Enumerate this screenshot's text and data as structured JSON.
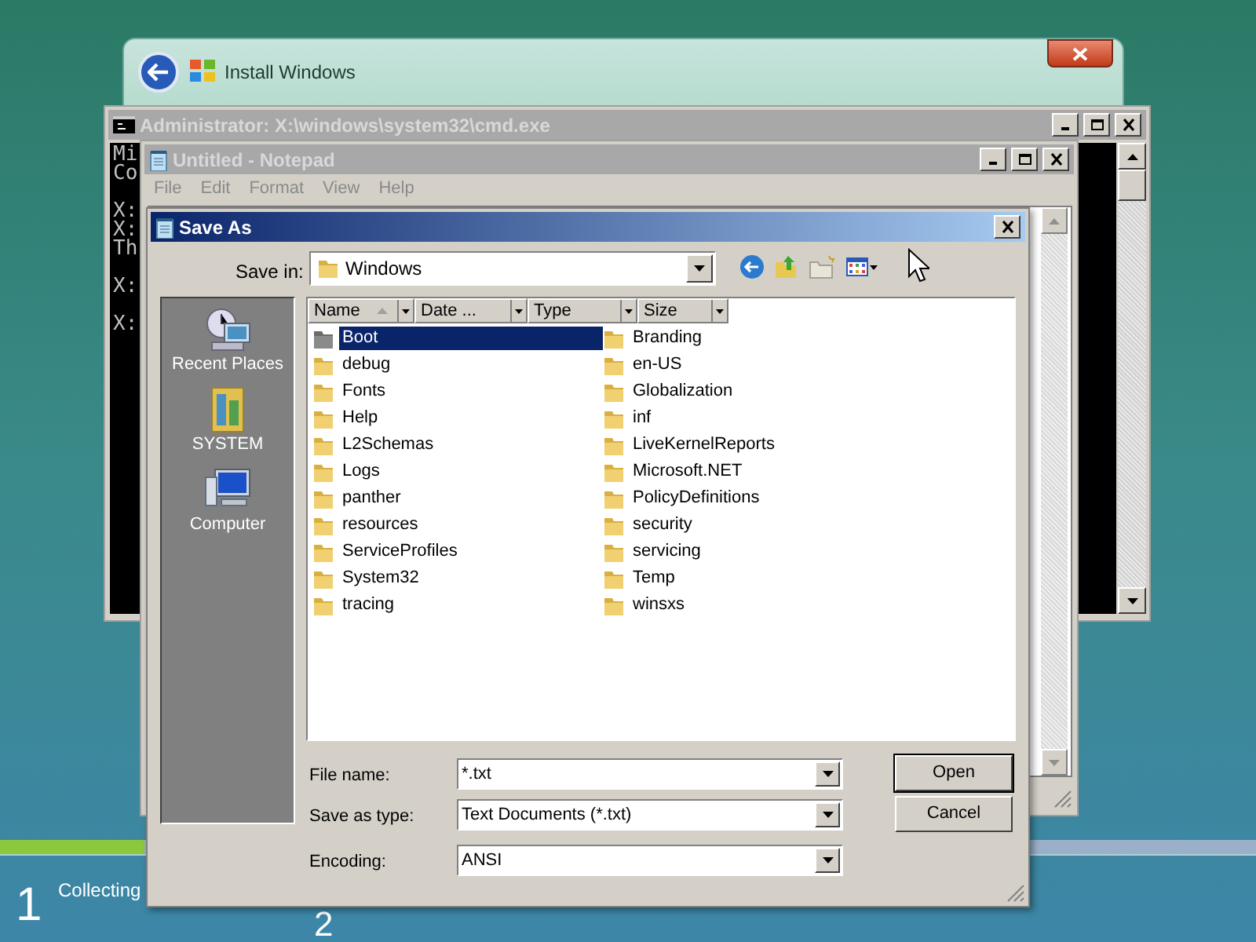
{
  "setup_window": {
    "title": "Install Windows"
  },
  "console_window": {
    "title": "Administrator: X:\\windows\\system32\\cmd.exe",
    "lines": [
      {
        "text": "Mi",
        "blank_before": false
      },
      {
        "text": "Co",
        "blank_before": false
      },
      {
        "text": "X:",
        "blank_before": true
      },
      {
        "text": "X:",
        "blank_before": false
      },
      {
        "text": "Th",
        "blank_before": false
      },
      {
        "text": "X:",
        "blank_before": true
      },
      {
        "text": "X:",
        "blank_before": true
      }
    ]
  },
  "notepad": {
    "title": "Untitled - Notepad",
    "menu": [
      "File",
      "Edit",
      "Format",
      "View",
      "Help"
    ]
  },
  "save_dialog": {
    "title": "Save As",
    "save_in_label": "Save in:",
    "save_in_value": "Windows",
    "places": [
      {
        "kind": "recent",
        "label": "Recent Places"
      },
      {
        "kind": "user",
        "label": "SYSTEM"
      },
      {
        "kind": "computer",
        "label": "Computer"
      }
    ],
    "columns": [
      {
        "label": "Name",
        "sorted": true
      },
      {
        "label": "Date ...",
        "sorted": false
      },
      {
        "label": "Type",
        "sorted": false
      },
      {
        "label": "Size",
        "sorted": false
      }
    ],
    "items": [
      {
        "name": "Boot",
        "selected": true
      },
      {
        "name": "debug",
        "selected": false
      },
      {
        "name": "Fonts",
        "selected": false
      },
      {
        "name": "Help",
        "selected": false
      },
      {
        "name": "L2Schemas",
        "selected": false
      },
      {
        "name": "Logs",
        "selected": false
      },
      {
        "name": "panther",
        "selected": false
      },
      {
        "name": "resources",
        "selected": false
      },
      {
        "name": "ServiceProfiles",
        "selected": false
      },
      {
        "name": "System32",
        "selected": false
      },
      {
        "name": "tracing",
        "selected": false
      },
      {
        "name": "Branding",
        "selected": false
      },
      {
        "name": "en-US",
        "selected": false
      },
      {
        "name": "Globalization",
        "selected": false
      },
      {
        "name": "inf",
        "selected": false
      },
      {
        "name": "LiveKernelReports",
        "selected": false
      },
      {
        "name": "Microsoft.NET",
        "selected": false
      },
      {
        "name": "PolicyDefinitions",
        "selected": false
      },
      {
        "name": "security",
        "selected": false
      },
      {
        "name": "servicing",
        "selected": false
      },
      {
        "name": "Temp",
        "selected": false
      },
      {
        "name": "winsxs",
        "selected": false
      }
    ],
    "fields": [
      {
        "label": "File name:",
        "value": "*.txt"
      },
      {
        "label": "Save as type:",
        "value": "Text Documents (*.txt)"
      },
      {
        "label": "Encoding:",
        "value": "ANSI"
      }
    ],
    "buttons": [
      "Open",
      "Cancel"
    ]
  },
  "setup_progress": {
    "level": 0.115,
    "steps": [
      {
        "number": "1",
        "label": "Collecting"
      },
      {
        "number": "2"
      }
    ]
  }
}
